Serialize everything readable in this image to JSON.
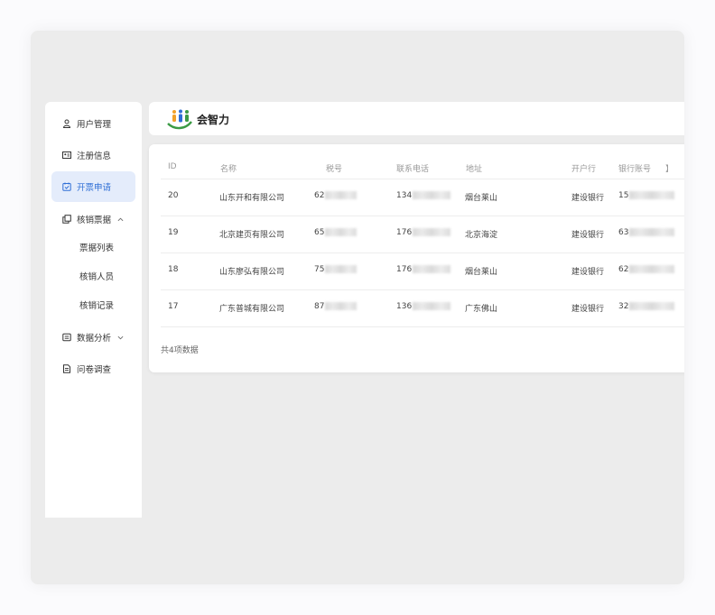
{
  "sidebar": {
    "items": [
      {
        "label": "用户管理",
        "icon": "user-icon"
      },
      {
        "label": "注册信息",
        "icon": "id-card-icon"
      },
      {
        "label": "开票申请",
        "icon": "invoice-icon",
        "active": true
      },
      {
        "label": "核销票据",
        "icon": "copy-icon",
        "expanded": true,
        "children": [
          {
            "label": "票据列表"
          },
          {
            "label": "核销人员"
          },
          {
            "label": "核销记录"
          }
        ]
      },
      {
        "label": "数据分析",
        "icon": "chart-box-icon",
        "expanded": false
      },
      {
        "label": "问卷调查",
        "icon": "document-icon"
      }
    ]
  },
  "header": {
    "logo_text": "会智力"
  },
  "table": {
    "columns": [
      "ID",
      "名称",
      "税号",
      "联系电话",
      "地址",
      "开户行",
      "银行账号",
      "】"
    ],
    "rows": [
      {
        "id": "20",
        "name": "山东开和有限公司",
        "tax": "62",
        "phone": "134",
        "address": "烟台莱山",
        "bank": "建设银行",
        "account": "15"
      },
      {
        "id": "19",
        "name": "北京建页有限公司",
        "tax": "65",
        "phone": "176",
        "address": "北京海淀",
        "bank": "建设银行",
        "account": "63"
      },
      {
        "id": "18",
        "name": "山东廖弘有限公司",
        "tax": "75",
        "phone": "176",
        "address": "烟台莱山",
        "bank": "建设银行",
        "account": "62"
      },
      {
        "id": "17",
        "name": "广东普城有限公司",
        "tax": "87",
        "phone": "136",
        "address": "广东佛山",
        "bank": "建设银行",
        "account": "32"
      }
    ],
    "total": "共4项数据"
  },
  "colors": {
    "accent": "#2f6fd6",
    "active_bg": "#e4ecfb"
  }
}
